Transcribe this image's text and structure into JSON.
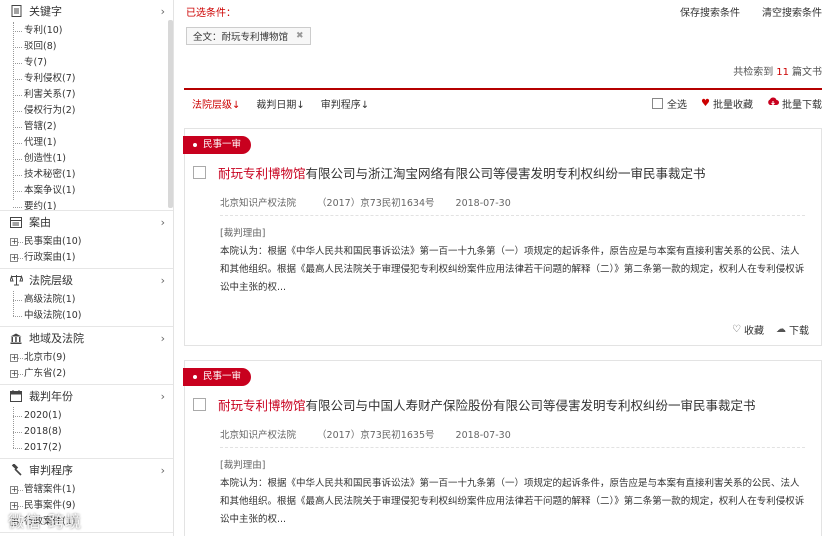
{
  "sidebar": {
    "facets": [
      {
        "title": "关键字",
        "icon": "document-icon",
        "items": [
          "专利(10)",
          "驳回(8)",
          "专(7)",
          "专利侵权(7)",
          "利害关系(7)",
          "侵权行为(2)",
          "管辖(2)",
          "代理(1)",
          "创造性(1)",
          "技术秘密(1)",
          "本案争议(1)",
          "要约(1)"
        ]
      },
      {
        "title": "案由",
        "icon": "list-icon",
        "items": [
          "民事案由(10)",
          "行政案由(1)"
        ]
      },
      {
        "title": "法院层级",
        "icon": "scale-icon",
        "items": [
          "高级法院(1)",
          "中级法院(10)"
        ]
      },
      {
        "title": "地域及法院",
        "icon": "courthouse-icon",
        "items": [
          "北京市(9)",
          "广东省(2)"
        ]
      },
      {
        "title": "裁判年份",
        "icon": "calendar-icon",
        "items": [
          "2020(1)",
          "2018(8)",
          "2017(2)"
        ]
      },
      {
        "title": "审判程序",
        "icon": "gavel-icon",
        "items": [
          "管辖案件(1)",
          "民事案件(9)",
          "行政案件(1)"
        ]
      }
    ]
  },
  "topbar": {
    "selected_label": "已选条件：",
    "save_search": "保存搜索条件",
    "clear_search": "清空搜索条件"
  },
  "chip": {
    "label": "全文：耐玩专利博物馆",
    "close": "✖"
  },
  "count": {
    "prefix": "共检索到",
    "number": "11",
    "suffix": "篇文书"
  },
  "sortbar": {
    "court_level": "法院层级↓",
    "judge_date": "裁判日期↓",
    "procedure": "审判程序↓",
    "select_all": "全选",
    "batch_fav": "批量收藏",
    "batch_download": "批量下载"
  },
  "results": [
    {
      "tag": "民事一审",
      "title_kw": "耐玩专利博物馆",
      "title_rest": "有限公司与浙江淘宝网络有限公司等侵害发明专利权纠纷一审民事裁定书",
      "court": "北京知识产权法院",
      "case_no": "（2017）京73民初1634号",
      "date": "2018-07-30",
      "reason_label": "[裁判理由]",
      "reason": "本院认为：根据《中华人民共和国民事诉讼法》第一百一十九条第（一）项规定的起诉条件，原告应是与本案有直接利害关系的公民、法人和其他组织。根据《最高人民法院关于审理侵犯专利权纠纷案件应用法律若干问题的解释（二）》第二条第一款的规定，权利人在专利侵权诉讼中主张的权...",
      "fav": "收藏",
      "download": "下载"
    },
    {
      "tag": "民事一审",
      "title_kw": "耐玩专利博物馆",
      "title_rest": "有限公司与中国人寿财产保险股份有限公司等侵害发明专利权纠纷一审民事裁定书",
      "court": "北京知识产权法院",
      "case_no": "（2017）京73民初1635号",
      "date": "2018-07-30",
      "reason_label": "[裁判理由]",
      "reason": "本院认为：根据《中华人民共和国民事诉讼法》第一百一十九条第（一）项规定的起诉条件，原告应是与本案有直接利害关系的公民、法人和其他组织。根据《最高人民法院关于审理侵犯专利权纠纷案件应用法律若干问题的解释（二）》第二条第一款的规定，权利人在专利侵权诉讼中主张的权...",
      "fav": "收藏",
      "download": "下载"
    }
  ],
  "watermark": "微信·跨境",
  "colors": {
    "accent": "#c8001e",
    "border": "#e3e3e3"
  }
}
